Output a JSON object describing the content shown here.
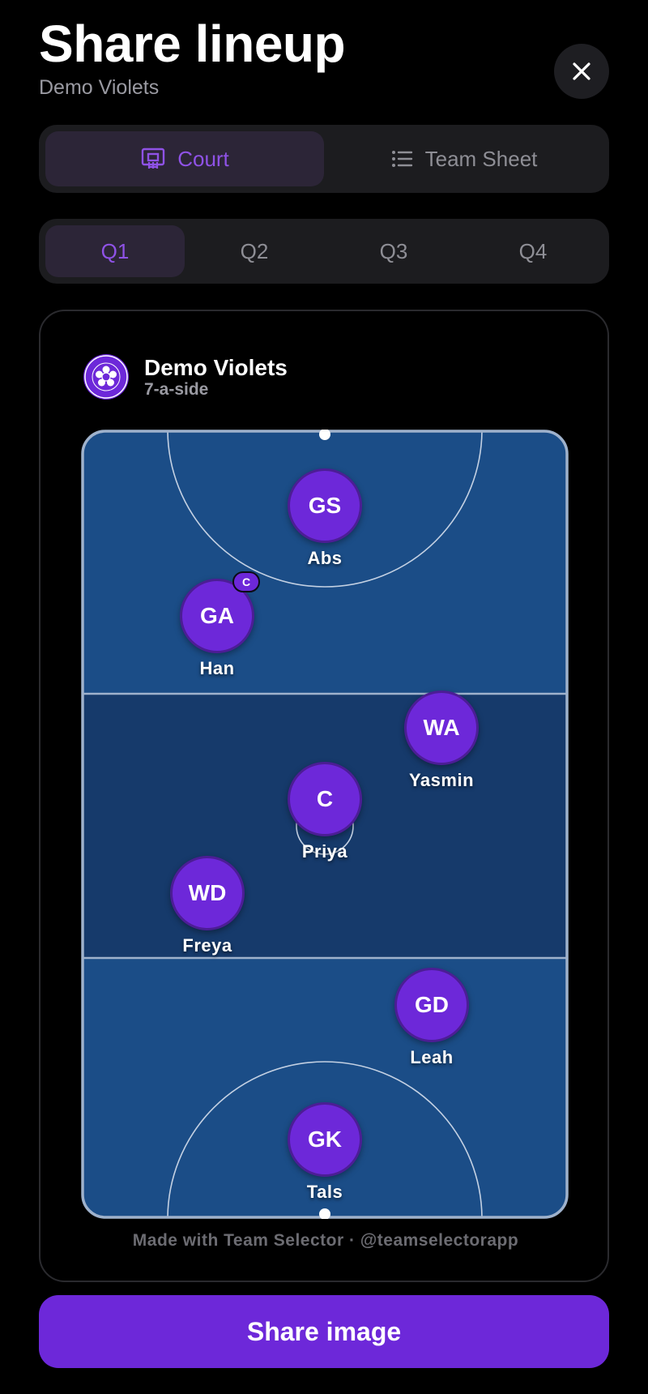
{
  "header": {
    "title": "Share lineup",
    "subtitle": "Demo Violets"
  },
  "view_tabs": [
    {
      "label": "Court",
      "icon": "court-icon",
      "active": true
    },
    {
      "label": "Team Sheet",
      "icon": "list-icon",
      "active": false
    }
  ],
  "quarters": [
    {
      "label": "Q1",
      "active": true
    },
    {
      "label": "Q2",
      "active": false
    },
    {
      "label": "Q3",
      "active": false
    },
    {
      "label": "Q4",
      "active": false
    }
  ],
  "card": {
    "team_name": "Demo Violets",
    "format": "7-a-side",
    "footer": "Made with Team Selector · @teamselectorapp"
  },
  "players": [
    {
      "position": "GS",
      "name": "Abs",
      "captain": false
    },
    {
      "position": "GA",
      "name": "Han",
      "captain": true
    },
    {
      "position": "WA",
      "name": "Yasmin",
      "captain": false
    },
    {
      "position": "C",
      "name": "Priya",
      "captain": false
    },
    {
      "position": "WD",
      "name": "Freya",
      "captain": false
    },
    {
      "position": "GD",
      "name": "Leah",
      "captain": false
    },
    {
      "position": "GK",
      "name": "Tals",
      "captain": false
    }
  ],
  "captain_badge": "C",
  "share_button": "Share image",
  "colors": {
    "accent": "#6d28d9",
    "court_outer": "#1b4d87",
    "court_centre": "#163a6b",
    "background": "#000000"
  }
}
